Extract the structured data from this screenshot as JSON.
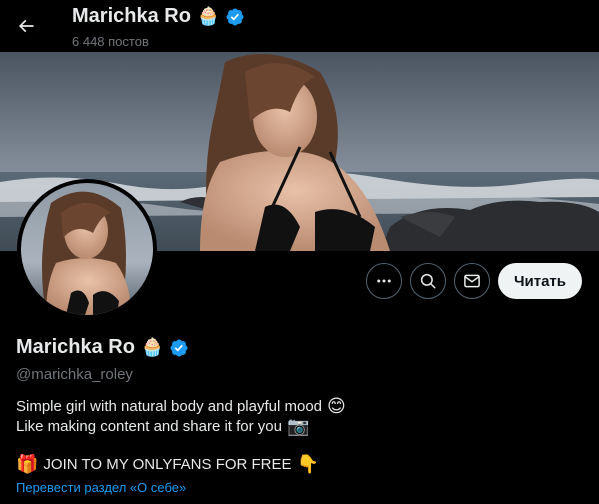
{
  "header": {
    "name": "Marichka Ro",
    "posts_count": "6 448 постов"
  },
  "profile": {
    "name": "Marichka Ro",
    "handle": "@marichka_roley",
    "name_emoji": "🧁",
    "verified": true
  },
  "actions": {
    "more_icon": "more-icon",
    "search_icon": "search-icon",
    "message_icon": "mail-icon",
    "follow_label": "Читать"
  },
  "bio": {
    "line1": "Simple girl with natural body and playful mood",
    "line1_emoji": "😊",
    "line2": "Like making content and share it for you",
    "line2_emoji": "📷",
    "line3_emoji": "🎁",
    "line3": "JOIN TO MY ONLYFANS FOR FREE",
    "line3_end_emoji": "👇"
  },
  "translate_link": "Перевести раздел «О себе»",
  "colors": {
    "background": "#000000",
    "primary_text": "#e7e9ea",
    "secondary_text": "#71767b",
    "link": "#1d9bf0",
    "verified_badge": "#1d9bf0"
  }
}
